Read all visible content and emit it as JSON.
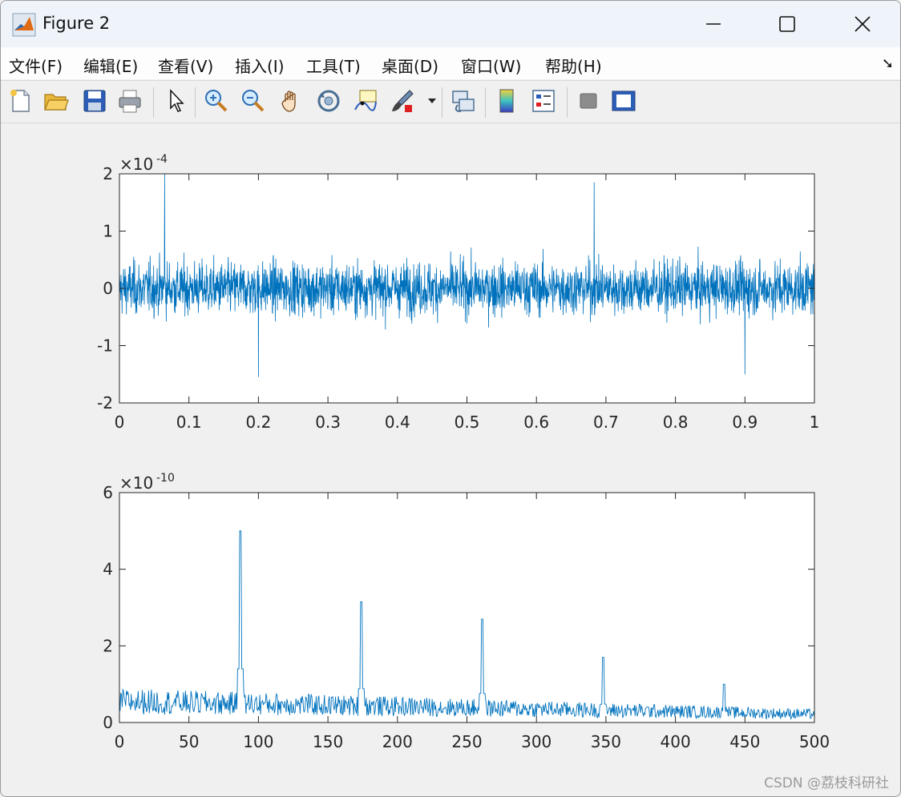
{
  "window": {
    "title": "Figure 2",
    "controls": [
      "minimize",
      "maximize",
      "close"
    ]
  },
  "menu": [
    "文件(F)",
    "编辑(E)",
    "查看(V)",
    "插入(I)",
    "工具(T)",
    "桌面(D)",
    "窗口(W)",
    "帮助(H)"
  ],
  "toolbar": [
    "new-figure-icon",
    "open-icon",
    "save-icon",
    "print-icon",
    "pointer-icon",
    "zoom-in-icon",
    "zoom-out-icon",
    "pan-icon",
    "rotate-icon",
    "data-cursor-icon",
    "brush-icon",
    "link-icon",
    "colorbar-icon",
    "legend-icon",
    "hide-plot-tools-icon",
    "show-plot-tools-icon"
  ],
  "colors": {
    "line": "#0072bd",
    "axes": "#262626",
    "plot_bg": "#ffffff",
    "figure_bg": "#f0f0f0"
  },
  "watermark": "CSDN @荔枝科研社",
  "chart_data": [
    {
      "type": "line",
      "exponent": "×10",
      "exponent_power": "-4",
      "x_ticks": [
        "0",
        "0.1",
        "0.2",
        "0.3",
        "0.4",
        "0.5",
        "0.6",
        "0.7",
        "0.8",
        "0.9",
        "1"
      ],
      "y_ticks": [
        "-2",
        "-1",
        "0",
        "1",
        "2"
      ],
      "xlim": [
        0,
        1
      ],
      "ylim": [
        -2,
        2
      ],
      "y_scale_factor": 0.0001,
      "grid": false,
      "description_of_series": "dense noise signal, values mostly within ±0.7e-4",
      "series": [
        {
          "x": [
            0.065,
            0.2,
            0.683,
            0.9
          ],
          "y": [
            2.0,
            -1.55,
            1.85,
            -1.5
          ]
        }
      ]
    },
    {
      "type": "line",
      "exponent": "×10",
      "exponent_power": "-10",
      "x_ticks": [
        "0",
        "50",
        "100",
        "150",
        "200",
        "250",
        "300",
        "350",
        "400",
        "450",
        "500"
      ],
      "y_ticks": [
        "0",
        "2",
        "4",
        "6"
      ],
      "xlim": [
        0,
        500
      ],
      "ylim": [
        0,
        6
      ],
      "y_scale_factor": 1e-10,
      "grid": false,
      "series": [
        {
          "x": [
            87,
            174,
            261,
            348,
            435
          ],
          "y": [
            5.0,
            3.15,
            2.7,
            1.7,
            1.0
          ]
        }
      ]
    }
  ]
}
